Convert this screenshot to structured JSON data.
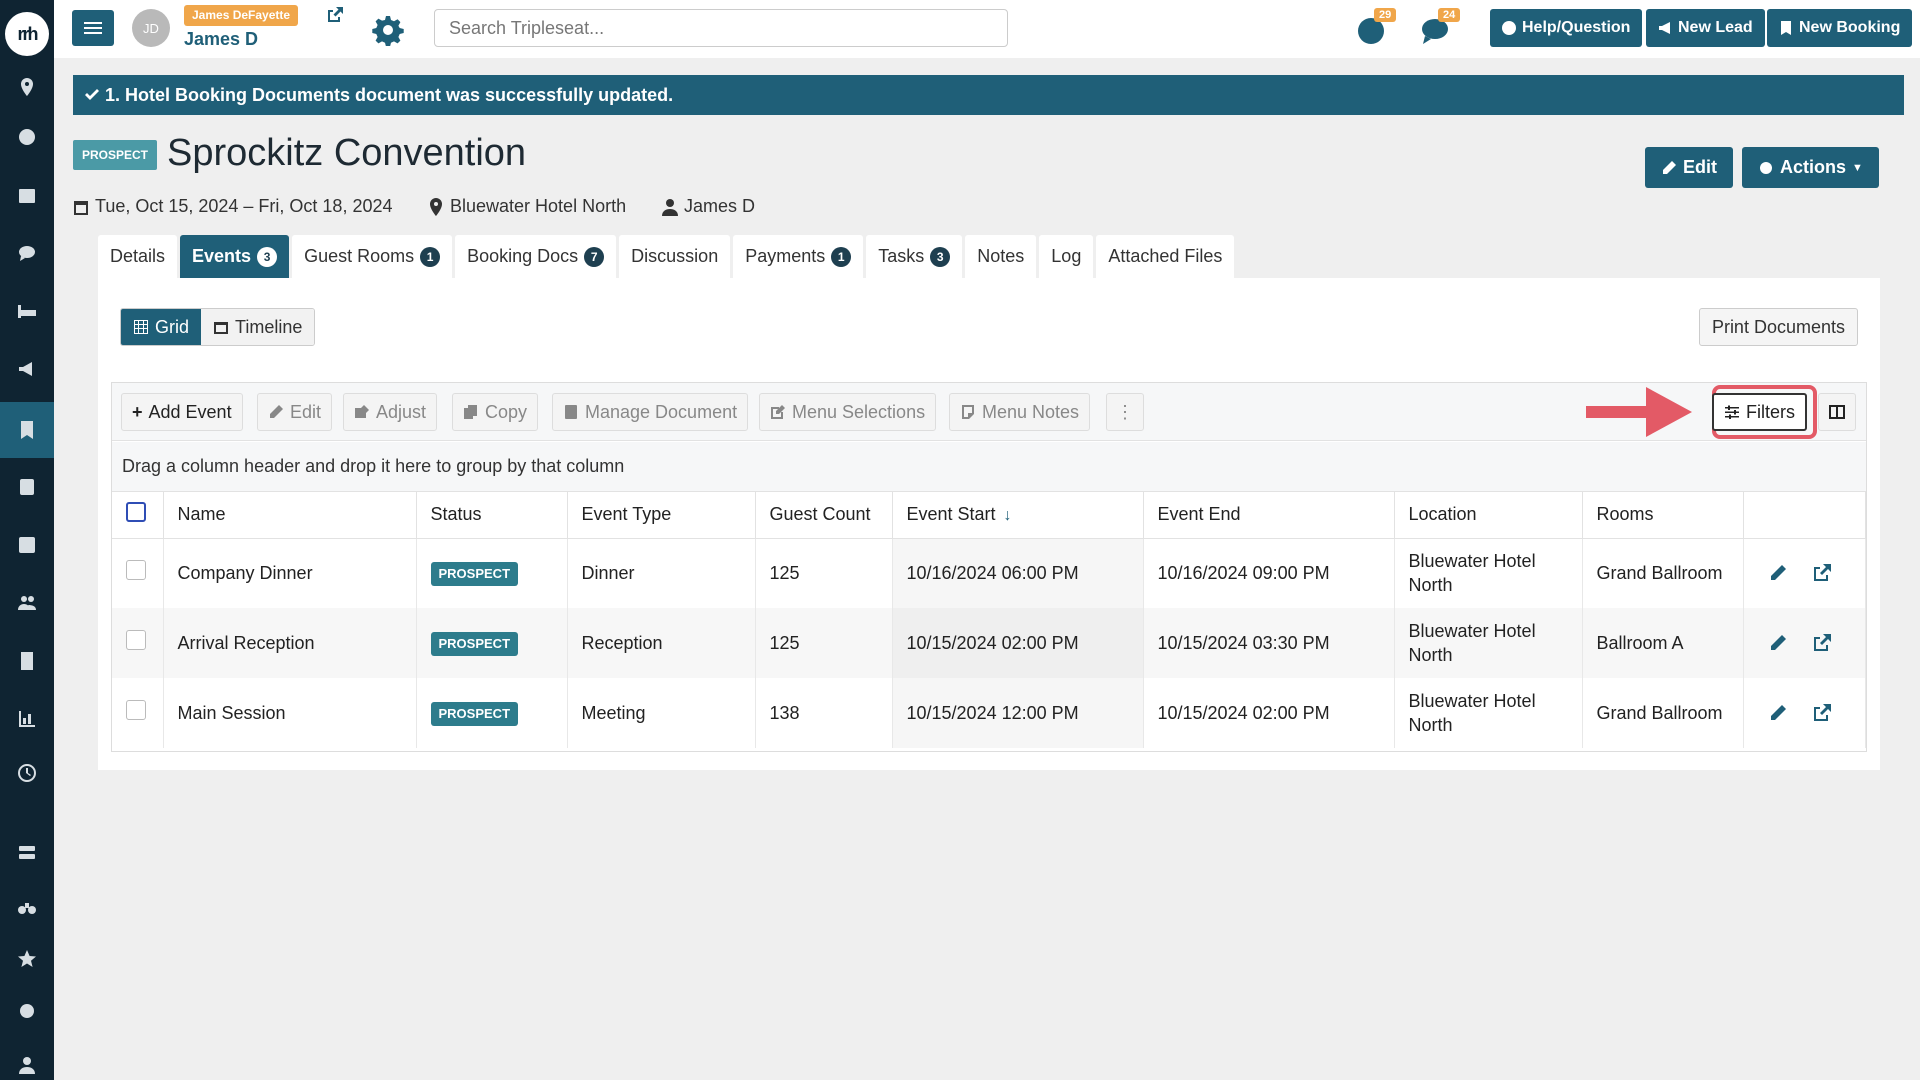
{
  "sidebar": {
    "logo_text": "rrh",
    "icons": [
      "location-icon",
      "dashboard-icon",
      "calendar-icon",
      "chat-icon",
      "bed-icon",
      "megaphone-icon",
      "bookmark-icon",
      "document-icon",
      "checkbox-icon",
      "users-icon",
      "building-icon",
      "chart-icon",
      "history-icon",
      "storage-icon",
      "binoculars-icon",
      "star-icon",
      "settings-icon",
      "user-icon"
    ]
  },
  "topbar": {
    "avatar_initials": "JD",
    "user_badge": "James DeFayette",
    "user_name": "James D",
    "search_placeholder": "Search Tripleseat...",
    "notif_count_1": "29",
    "notif_count_2": "24",
    "help_label": "Help/Question",
    "new_lead_label": "New Lead",
    "new_booking_label": "New Booking"
  },
  "alert": {
    "message": "1. Hotel Booking Documents document was successfully updated."
  },
  "header": {
    "status_badge": "PROSPECT",
    "title": "Sprockitz Convention",
    "dates": "Tue, Oct 15, 2024 – Fri, Oct 18, 2024",
    "location": "Bluewater Hotel North",
    "owner": "James D",
    "edit_label": "Edit",
    "actions_label": "Actions"
  },
  "tabs": [
    {
      "label": "Details",
      "count": ""
    },
    {
      "label": "Events",
      "count": "3"
    },
    {
      "label": "Guest Rooms",
      "count": "1"
    },
    {
      "label": "Booking Docs",
      "count": "7"
    },
    {
      "label": "Discussion",
      "count": ""
    },
    {
      "label": "Payments",
      "count": "1"
    },
    {
      "label": "Tasks",
      "count": "3"
    },
    {
      "label": "Notes",
      "count": ""
    },
    {
      "label": "Log",
      "count": ""
    },
    {
      "label": "Attached Files",
      "count": ""
    }
  ],
  "view": {
    "grid_label": "Grid",
    "timeline_label": "Timeline",
    "print_label": "Print Documents"
  },
  "toolbar": {
    "add_event": "Add Event",
    "edit": "Edit",
    "adjust": "Adjust",
    "copy": "Copy",
    "manage_document": "Manage Document",
    "menu_selections": "Menu Selections",
    "menu_notes": "Menu Notes",
    "filters": "Filters"
  },
  "group_hint": "Drag a column header and drop it here to group by that column",
  "columns": [
    "Name",
    "Status",
    "Event Type",
    "Guest Count",
    "Event Start",
    "Event End",
    "Location",
    "Rooms"
  ],
  "rows": [
    {
      "name": "Company Dinner",
      "status": "PROSPECT",
      "type": "Dinner",
      "guests": "125",
      "start": "10/16/2024 06:00 PM",
      "end": "10/16/2024 09:00 PM",
      "location": "Bluewater Hotel North",
      "rooms": "Grand Ballroom"
    },
    {
      "name": "Arrival Reception",
      "status": "PROSPECT",
      "type": "Reception",
      "guests": "125",
      "start": "10/15/2024 02:00 PM",
      "end": "10/15/2024 03:30 PM",
      "location": "Bluewater Hotel North",
      "rooms": "Ballroom A"
    },
    {
      "name": "Main Session",
      "status": "PROSPECT",
      "type": "Meeting",
      "guests": "138",
      "start": "10/15/2024 12:00 PM",
      "end": "10/15/2024 02:00 PM",
      "location": "Bluewater Hotel North",
      "rooms": "Grand Ballroom"
    }
  ]
}
